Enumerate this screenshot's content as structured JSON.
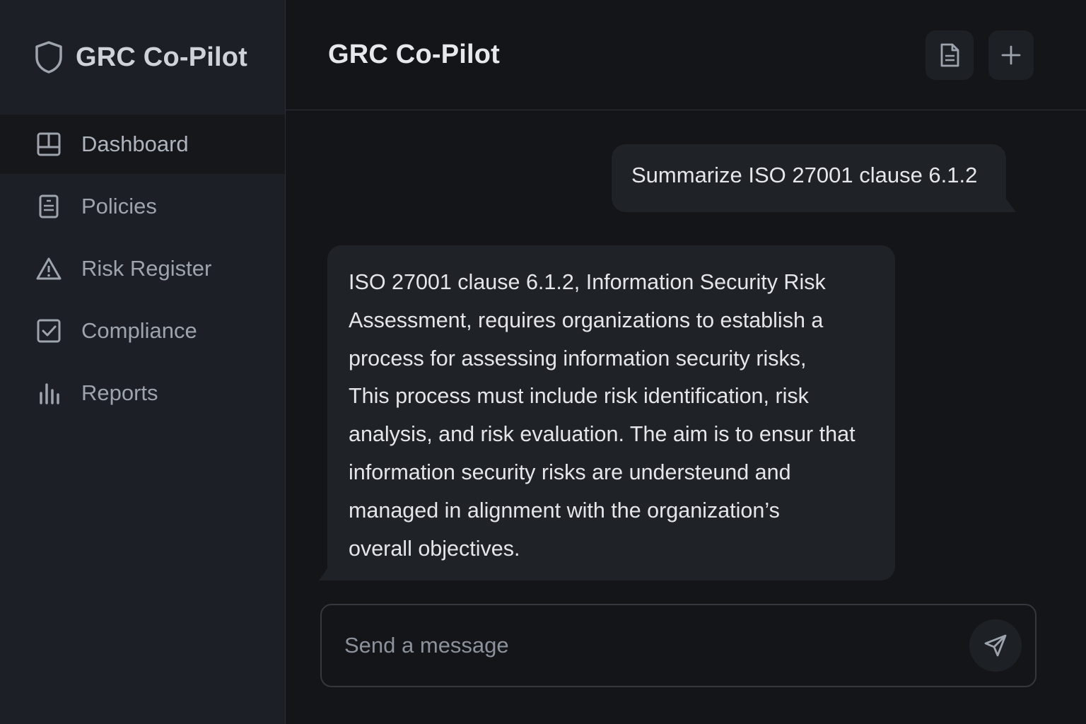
{
  "app": {
    "title": "GRC Co-Pilot"
  },
  "sidebar": {
    "brand": "GRC Co-Pilot",
    "items": [
      {
        "label": "Dashboard",
        "icon": "layout-grid-icon",
        "active": true
      },
      {
        "label": "Policies",
        "icon": "document-list-icon",
        "active": false
      },
      {
        "label": "Risk Register",
        "icon": "warning-triangle-icon",
        "active": false
      },
      {
        "label": "Compliance",
        "icon": "checkbox-icon",
        "active": false
      },
      {
        "label": "Reports",
        "icon": "bar-chart-icon",
        "active": false
      }
    ]
  },
  "header": {
    "title": "GRC Co-Pilot",
    "buttons": [
      {
        "icon": "document-icon"
      },
      {
        "icon": "plus-icon"
      }
    ]
  },
  "chat": {
    "user_message": "Summarize ISO 27001 clause 6.1.2",
    "assistant_lines": [
      "ISO 27001 clause 6.1.2, Information Security Risk",
      "Assessment, requires organizations to establish a",
      "process for assessing information security risks,",
      "This process must include risk identification, risk",
      "analysis, and risk evaluation. The aim is to ensur that",
      "information security risks are understeund and",
      "managed in alignment with the organization’s",
      "overall objectives."
    ]
  },
  "composer": {
    "placeholder": "Send a message",
    "value": ""
  },
  "colors": {
    "background": "#131519",
    "sidebar": "#1c1f25",
    "bubble": "#1f2227",
    "text": "#e4e6e9"
  }
}
